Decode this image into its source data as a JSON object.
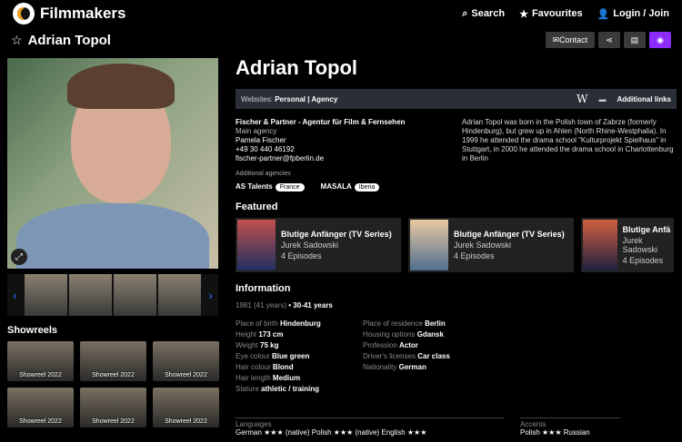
{
  "header": {
    "brand": "Filmmakers",
    "nav": [
      {
        "icon": "search-icon",
        "label": "Search"
      },
      {
        "icon": "star-icon",
        "label": "Favourites"
      },
      {
        "icon": "user-icon",
        "label": "Login / Join"
      }
    ]
  },
  "titlebar": {
    "name": "Adrian Topol",
    "contact": "Contact"
  },
  "profile": {
    "name": "Adrian Topol"
  },
  "websites": {
    "label": "Websites:",
    "links": "Personal | Agency",
    "additional": "Additional links"
  },
  "agency": {
    "name": "Fischer & Partner - Agentur für Film & Fernsehen",
    "type": "Main agency",
    "contact": "Pamela Fischer",
    "phone": "+49 30 440 46192",
    "email": "fischer-partner@fpberlin.de"
  },
  "bio": "Adrian Topol was born in the Polish town of Zabrze (formerly Hindenburg), but grew up in Ahlen (North Rhine-Westphalia). In 1999 he attended the drama school \"Kulturprojekt Spielhaus\" in Stuttgart, in 2000 he attended the drama school in Charlottenburg in Berlin",
  "additional_agencies": {
    "label": "Additional agencies",
    "items": [
      {
        "name": "AS Talents",
        "country": "France"
      },
      {
        "name": "MASALA",
        "country": "Iberia"
      }
    ]
  },
  "featured": {
    "title": "Featured",
    "cards": [
      {
        "title": "Blutige Anfänger (TV Series)",
        "role": "Jurek Sadowski",
        "episodes": "4 Episodes"
      },
      {
        "title": "Blutige Anfänger (TV Series)",
        "role": "Jurek Sadowski",
        "episodes": "4 Episodes"
      },
      {
        "title": "Blutige Anfä",
        "role": "Jurek Sadowski",
        "episodes": "4 Episodes"
      }
    ]
  },
  "information": {
    "title": "Information",
    "year": "1981 (41 years)",
    "range": "• 30-41 years",
    "left": [
      {
        "k": "Place of birth",
        "v": "Hindenburg"
      },
      {
        "k": "Height",
        "v": "173 cm"
      },
      {
        "k": "Weight",
        "v": "75 kg"
      },
      {
        "k": "Eye colour",
        "v": "Blue green"
      },
      {
        "k": "Hair colour",
        "v": "Blond"
      },
      {
        "k": "Hair length",
        "v": "Medium"
      },
      {
        "k": "Stature",
        "v": "athletic / training"
      }
    ],
    "right": [
      {
        "k": "Place of residence",
        "v": "Berlin"
      },
      {
        "k": "Housing options",
        "v": "Gdansk"
      },
      {
        "k": "Profession",
        "v": "Actor"
      },
      {
        "k": "Driver's licenses",
        "v": "Car class"
      },
      {
        "k": "Nationality",
        "v": "German"
      }
    ]
  },
  "languages": {
    "label": "Languages",
    "items": "German ★★★ (native)   Polish ★★★ (native)   English ★★★"
  },
  "accents": {
    "label": "Accents",
    "items": "Polish ★★★   Russian"
  },
  "showreels": {
    "title": "Showreels",
    "items": [
      "Showreel 2022",
      "Showreel 2022",
      "Showreel 2022",
      "Showreel 2022",
      "Showreel 2022",
      "Showreel 2022"
    ]
  }
}
